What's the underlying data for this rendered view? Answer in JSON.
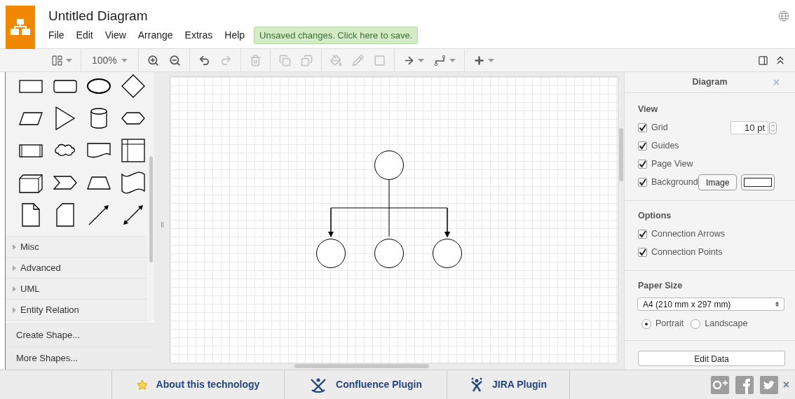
{
  "window": {
    "title": "Untitled Diagram"
  },
  "menu": [
    "File",
    "Edit",
    "View",
    "Arrange",
    "Extras",
    "Help"
  ],
  "save_notice": "Unsaved changes. Click here to save.",
  "toolbar": {
    "zoom": "100%",
    "tools": [
      {
        "kind": "format",
        "disabled": false
      },
      {
        "kind": "zoom"
      },
      {
        "kind": "zoom-in",
        "disabled": false
      },
      {
        "kind": "zoom-out",
        "disabled": false
      },
      {
        "kind": "undo",
        "disabled": false
      },
      {
        "kind": "redo",
        "disabled": true
      },
      {
        "kind": "delete",
        "disabled": true
      },
      {
        "kind": "to-front",
        "disabled": true
      },
      {
        "kind": "to-back",
        "disabled": true
      },
      {
        "kind": "fill",
        "disabled": true
      },
      {
        "kind": "line",
        "disabled": true
      },
      {
        "kind": "shadow",
        "disabled": true
      },
      {
        "kind": "connection",
        "disabled": false
      },
      {
        "kind": "waypoint",
        "disabled": false
      },
      {
        "kind": "insert",
        "disabled": false
      }
    ]
  },
  "sidebar": {
    "sections": [
      {
        "label": "Misc",
        "expanded": false
      },
      {
        "label": "Advanced",
        "expanded": false
      },
      {
        "label": "UML",
        "expanded": false
      },
      {
        "label": "Entity Relation",
        "expanded": false
      }
    ],
    "actions": [
      "Create Shape...",
      "More Shapes..."
    ]
  },
  "panel": {
    "title": "Diagram",
    "close": "×",
    "view": {
      "heading": "View",
      "options": [
        {
          "label": "Grid",
          "checked": true
        },
        {
          "label": "Guides",
          "checked": true
        },
        {
          "label": "Page View",
          "checked": true
        },
        {
          "label": "Background",
          "checked": true
        }
      ],
      "grid_size": "10 pt",
      "image_button": "Image"
    },
    "options": {
      "heading": "Options",
      "options": [
        {
          "label": "Connection Arrows",
          "checked": true
        },
        {
          "label": "Connection Points",
          "checked": true
        }
      ]
    },
    "paper": {
      "heading": "Paper Size",
      "size": "A4 (210 mm x 297 mm)",
      "orientations": [
        {
          "label": "Portrait",
          "selected": true
        },
        {
          "label": "Landscape",
          "selected": false
        }
      ]
    },
    "edit_data": "Edit Data"
  },
  "footer": {
    "links": [
      "About this technology",
      "Confluence Plugin",
      "JIRA Plugin"
    ],
    "close": "×"
  }
}
